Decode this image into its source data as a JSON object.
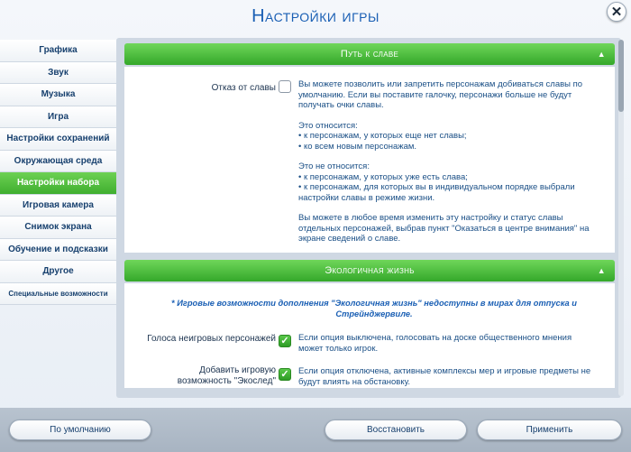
{
  "window": {
    "title": "Настройки игры"
  },
  "sidebar": {
    "items": [
      {
        "label": "Графика"
      },
      {
        "label": "Звук"
      },
      {
        "label": "Музыка"
      },
      {
        "label": "Игра"
      },
      {
        "label": "Настройки сохранений"
      },
      {
        "label": "Окружающая среда"
      },
      {
        "label": "Настройки набора"
      },
      {
        "label": "Игровая камера"
      },
      {
        "label": "Снимок экрана"
      },
      {
        "label": "Обучение и подсказки"
      },
      {
        "label": "Другое"
      },
      {
        "label": "Специальные возможности"
      }
    ],
    "active_index": 6
  },
  "sections": {
    "fame": {
      "title": "Путь к славе",
      "option": {
        "label": "Отказ от славы",
        "checked": false,
        "desc1": "Вы можете позволить или запретить персонажам добиваться славы по умолчанию. Если вы поставите галочку, персонажи больше не будут получать очки славы.",
        "desc2": "Это относится:\n• к персонажам, у которых еще нет славы;\n• ко всем новым персонажам.",
        "desc3": "Это не относится:\n• к персонажам, у которых уже есть слава;\n• к персонажам, для которых вы в индивидуальном порядке выбрали настройки славы в режиме жизни.",
        "desc4": "Вы можете в любое время изменить эту настройку и статус славы отдельных персонажей, выбрав пункт \"Оказаться в центре внимания\" на экране сведений о славе."
      }
    },
    "eco": {
      "title": "Экологичная жизнь",
      "note": "* Игровые возможности дополнения \"Экологичная жизнь\" недоступны в мирах для отпуска и Стрейнджервиле.",
      "options": [
        {
          "label": "Голоса неигровых персонажей",
          "checked": true,
          "desc": "Если опция выключена, голосовать на доске общественного мнения может только игрок."
        },
        {
          "label": "Добавить игровую возможность \"Экослед\"",
          "checked": true,
          "desc": "Если опция отключена, активные комплексы мер и игровые предметы не будут влиять на обстановку."
        }
      ]
    }
  },
  "footer": {
    "default_label": "По умолчанию",
    "restore_label": "Восстановить",
    "apply_label": "Применить"
  }
}
